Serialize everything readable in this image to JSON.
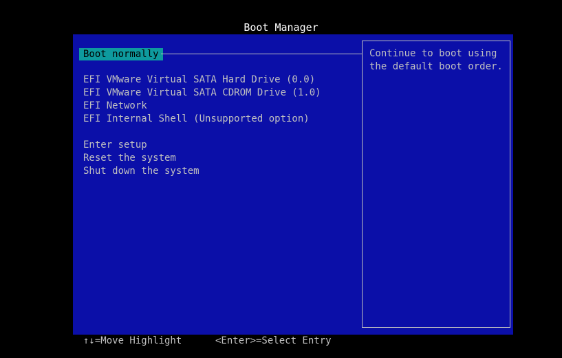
{
  "title": "Boot Manager",
  "selected_item": "Boot normally",
  "menu_groups": {
    "devices": [
      "EFI VMware Virtual SATA Hard Drive (0.0)",
      "EFI VMware Virtual SATA CDROM Drive (1.0)",
      "EFI Network",
      "EFI Internal Shell (Unsupported option)"
    ],
    "actions": [
      "Enter setup",
      "Reset the system",
      "Shut down the system"
    ]
  },
  "help_text": "Continue to boot using the default boot order.",
  "footer": {
    "move_hint": "↑↓=Move Highlight",
    "select_hint": "<Enter>=Select Entry"
  },
  "colors": {
    "screen_background": "#000000",
    "panel_background": "#0b0fa8",
    "highlight_background": "#0e9a9e",
    "text": "#c0c0c0",
    "title_text": "#ffffff"
  }
}
